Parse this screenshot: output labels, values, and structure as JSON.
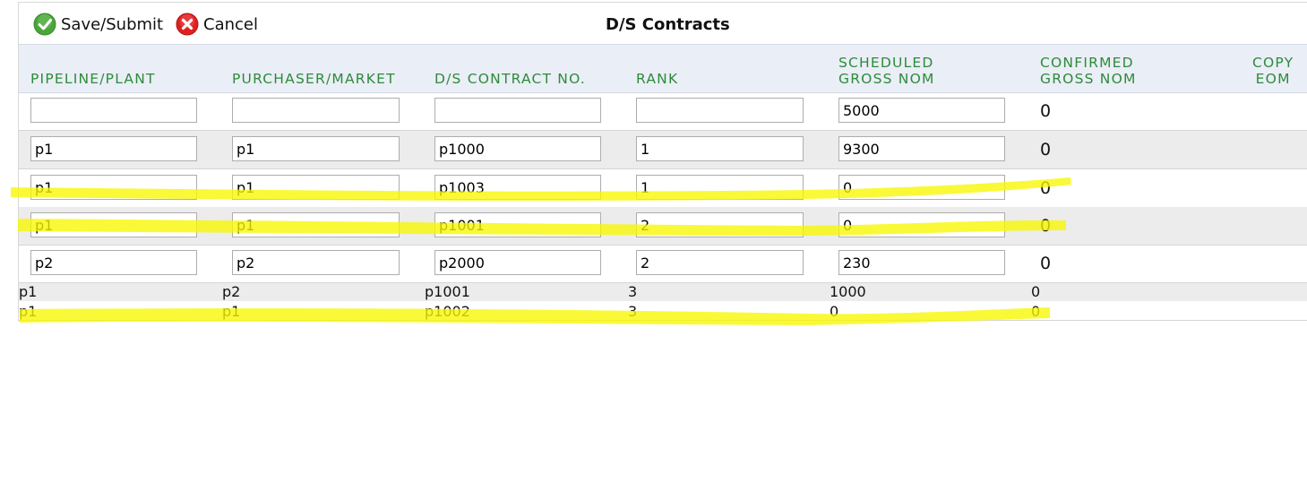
{
  "toolbar": {
    "save_label": "Save/Submit",
    "cancel_label": "Cancel",
    "title": "D/S Contracts"
  },
  "columns": {
    "pipeline": "PIPELINE/PLANT",
    "purchaser": "PURCHASER/MARKET",
    "contract": "D/S CONTRACT NO.",
    "rank": "RANK",
    "scheduled_1": "SCHEDULED",
    "scheduled_2": "GROSS NOM",
    "confirmed_1": "CONFIRMED",
    "confirmed_2": "GROSS NOM",
    "copy_1": "COPY",
    "copy_2": "EOM"
  },
  "edit_rows": [
    {
      "pipeline": "",
      "purchaser": "",
      "contract": "",
      "rank": "",
      "scheduled": "5000",
      "confirmed": "0"
    },
    {
      "pipeline": "p1",
      "purchaser": "p1",
      "contract": "p1000",
      "rank": "1",
      "scheduled": "9300",
      "confirmed": "0"
    },
    {
      "pipeline": "p1",
      "purchaser": "p1",
      "contract": "p1003",
      "rank": "1",
      "scheduled": "0",
      "confirmed": "0"
    },
    {
      "pipeline": "p1",
      "purchaser": "p1",
      "contract": "p1001",
      "rank": "2",
      "scheduled": "0",
      "confirmed": "0"
    },
    {
      "pipeline": "p2",
      "purchaser": "p2",
      "contract": "p2000",
      "rank": "2",
      "scheduled": "230",
      "confirmed": "0"
    }
  ],
  "text_rows": [
    {
      "pipeline": "p1",
      "purchaser": "p2",
      "contract": "p1001",
      "rank": "3",
      "scheduled": "1000",
      "confirmed": "0"
    },
    {
      "pipeline": "p1",
      "purchaser": "p1",
      "contract": "p1002",
      "rank": "3",
      "scheduled": "0",
      "confirmed": "0"
    }
  ],
  "colors": {
    "header_text": "#2e8b3a",
    "highlight": "#f7f700",
    "save_icon": "#4aa53a",
    "cancel_icon": "#e02020"
  },
  "icons": {
    "save": "check-circle-icon",
    "cancel": "x-circle-icon"
  }
}
